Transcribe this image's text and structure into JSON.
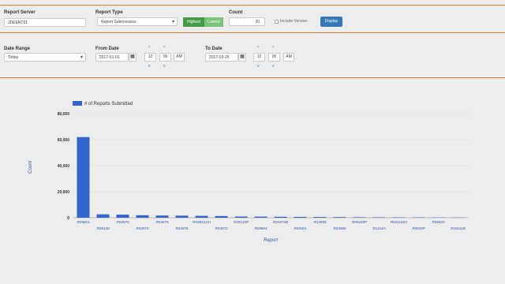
{
  "filters": {
    "report_server_label": "Report Server",
    "report_server_value": "JDEENT01",
    "report_type_label": "Report Type",
    "report_type_value": "Report Submissions",
    "toggle_highest": "Highest",
    "toggle_lowest": "Lowest",
    "count_label": "Count",
    "count_value": "20",
    "include_version_label": "Include Version",
    "display_button": "Display"
  },
  "dates": {
    "range_label": "Date Range",
    "range_value": "Today",
    "from_label": "From Date",
    "from_value": "2017-01-01",
    "from_hour": "12",
    "from_minute": "00",
    "from_ampm": "AM",
    "to_label": "To Date",
    "to_value": "2017-03-25",
    "to_hour": "12",
    "to_minute": "00",
    "to_ampm": "AM"
  },
  "icons": {
    "calendar": "calendar-icon",
    "up": "chevron-up-icon",
    "down": "chevron-down-icon",
    "dropdown": "caret-down-icon"
  },
  "colors": {
    "accent": "#e8742b",
    "bar": "#3366cc",
    "button": "#337ab7",
    "toggle_on": "#5cb85c",
    "toggle_off": "#8fcf8f"
  },
  "chart_data": {
    "type": "bar",
    "legend": "# of Reports Submitted",
    "legend_position": "top-left",
    "xlabel": "Report",
    "ylabel": "Count",
    "ylim": [
      0,
      80000
    ],
    "yticks": [
      "0",
      "20,000",
      "40,000",
      "60,000",
      "80,000"
    ],
    "grid": true,
    "categories": [
      "R09801",
      "R09130",
      "R04570",
      "R04571",
      "R04575",
      "R04576",
      "R03B11Z1I",
      "R04572",
      "R09132P",
      "R09804",
      "R04572B",
      "R09301",
      "R12855",
      "R04586",
      "R09200P",
      "R1414A",
      "R04110ZA",
      "R0010P",
      "R09420",
      "R10111B"
    ],
    "values": [
      62000,
      2600,
      2400,
      1900,
      1700,
      1600,
      1450,
      1300,
      900,
      850,
      750,
      650,
      550,
      480,
      400,
      350,
      300,
      250,
      200,
      150
    ]
  }
}
